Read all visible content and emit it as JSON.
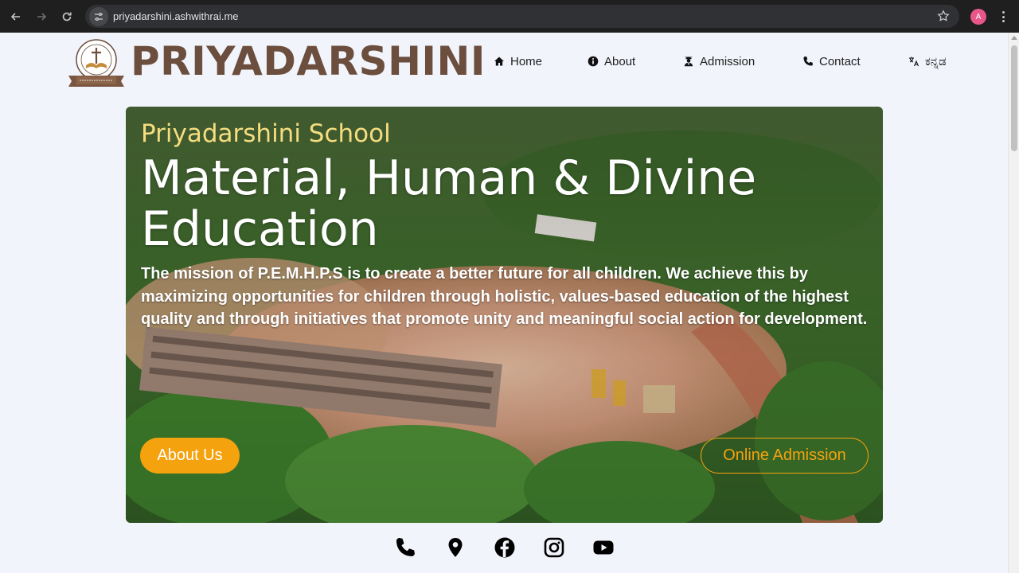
{
  "browser": {
    "url": "priyadarshini.ashwithrai.me",
    "profile_initial": "A"
  },
  "site": {
    "brand": "PRIYADARSHINI",
    "nav": [
      {
        "label": "Home",
        "icon": "home-icon"
      },
      {
        "label": "About",
        "icon": "info-icon"
      },
      {
        "label": "Admission",
        "icon": "graduate-icon"
      },
      {
        "label": "Contact",
        "icon": "phone-icon"
      },
      {
        "label": "ಕನ್ನಡ",
        "icon": "translate-icon"
      }
    ]
  },
  "hero": {
    "kicker": "Priyadarshini School",
    "title": "Material, Human & Divine Education",
    "text": "The mission of P.E.M.H.P.S is to create a better future for all children. We achieve this by maximizing opportunities for children through holistic, values-based education of the highest quality and through initiatives that promote unity and meaningful social action for development.",
    "primary_button": "About Us",
    "secondary_button": "Online Admission"
  },
  "social": [
    "phone-icon",
    "location-pin-icon",
    "facebook-icon",
    "instagram-icon",
    "youtube-icon"
  ],
  "colors": {
    "brand": "#6b4e3d",
    "accent": "#f5a20f",
    "kicker": "#f6dd7f",
    "page_bg": "#f2f4fb"
  }
}
